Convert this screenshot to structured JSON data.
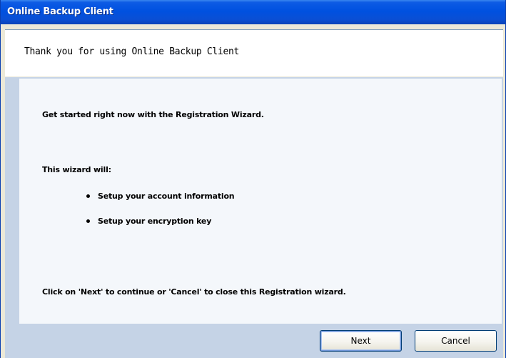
{
  "window": {
    "title": "Online Backup Client"
  },
  "header": {
    "text": "Thank you for using Online Backup Client"
  },
  "content": {
    "intro": "Get started right now with the Registration Wizard.",
    "wizard_will": "This wizard will:",
    "bullets": [
      "Setup your account information",
      "Setup your encryption key"
    ],
    "footer_note": "Click on 'Next' to continue or 'Cancel' to close this Registration wizard."
  },
  "buttons": {
    "next_label": "Next",
    "cancel_label": "Cancel"
  },
  "colors": {
    "titlebar": "#0051e0",
    "panel_border": "#c5d3e6",
    "content_bg": "#f4f7fb"
  }
}
